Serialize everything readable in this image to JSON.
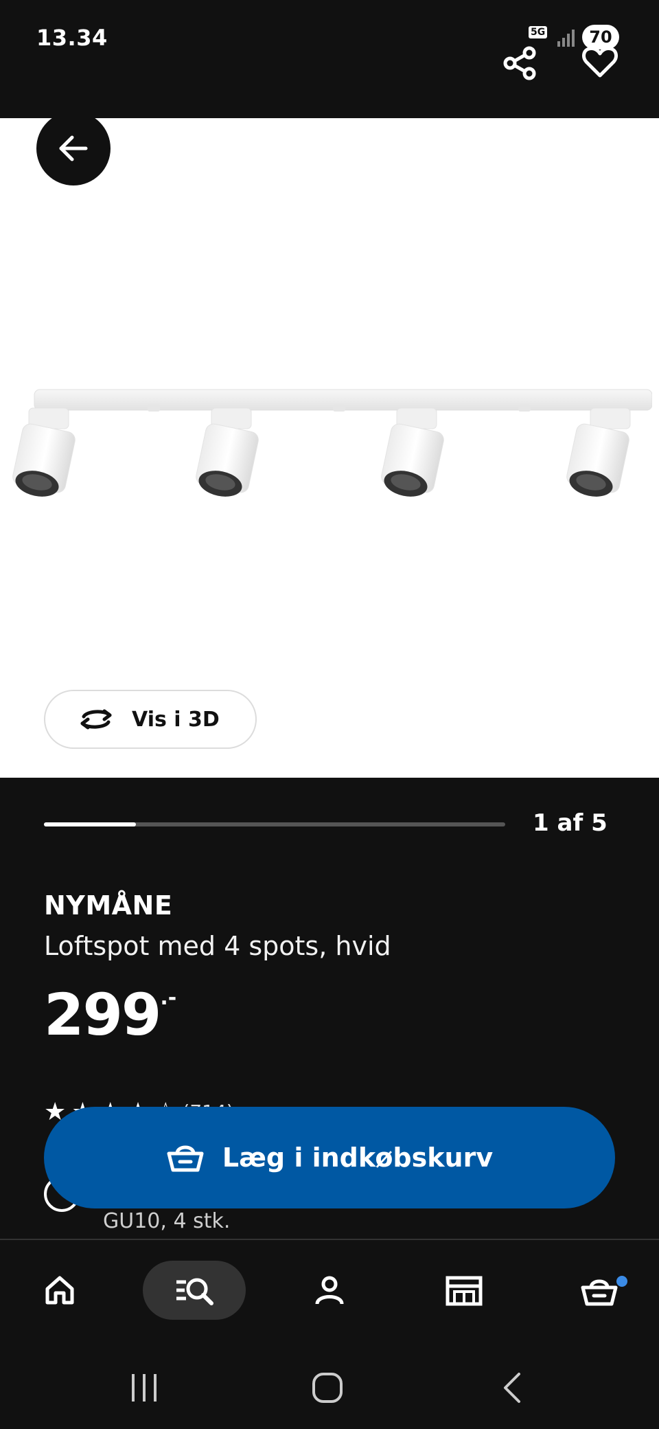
{
  "status_bar": {
    "time": "13.34",
    "network": "5G",
    "battery": "70"
  },
  "header": {
    "share_icon": "share-icon",
    "favorite_icon": "heart-icon",
    "back_icon": "arrow-left-icon"
  },
  "gallery": {
    "view_3d_label": "Vis i 3D",
    "counter": "1 af 5",
    "progress": 0.2
  },
  "product": {
    "name": "NYMÅNE",
    "description": "Loftspot med 4 spots, hvid",
    "price": "299",
    "price_suffix": ".-",
    "rating_count": "(714)",
    "info_text": "GU10, 4 stk."
  },
  "cta": {
    "add_to_cart_label": "Læg i indkøbskurv"
  },
  "bottom_nav": {
    "items": [
      {
        "icon": "home-icon"
      },
      {
        "icon": "search-list-icon",
        "active": true
      },
      {
        "icon": "profile-icon"
      },
      {
        "icon": "store-icon"
      },
      {
        "icon": "cart-icon",
        "has_badge": true
      }
    ]
  },
  "colors": {
    "background": "#111111",
    "accent": "#0058a3",
    "badge": "#3b8be6"
  }
}
